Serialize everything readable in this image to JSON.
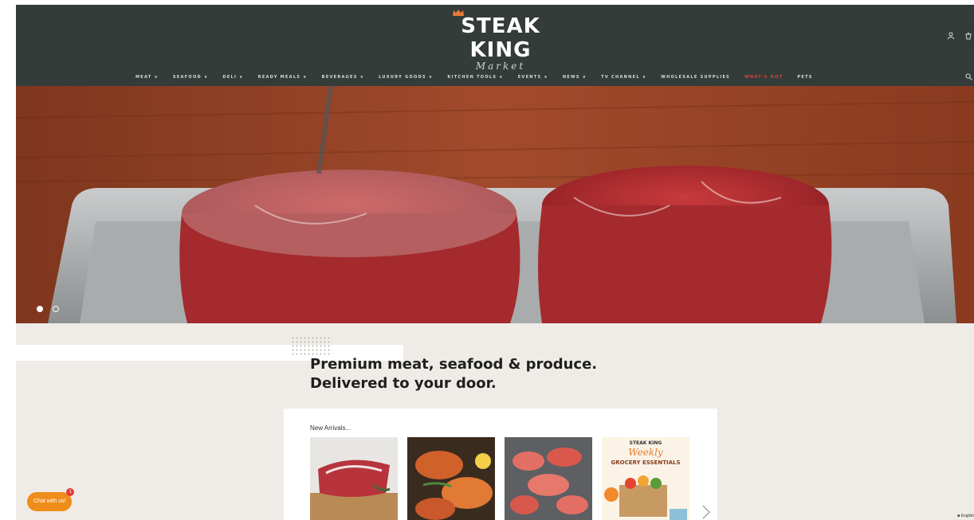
{
  "brand": {
    "title": "STEAK KING",
    "subtitle": "Market"
  },
  "nav": {
    "items": [
      "MEAT ∨",
      "SEAFOOD ∨",
      "DELI ∨",
      "READY MEALS ∨",
      "BEVERAGES ∨",
      "LUXURY GOODS ∨",
      "KITCHEN TOOLS ∨",
      "EVENTS ∨",
      "NEWS ∨",
      "TV CHANNEL ∨",
      "WHOLESALE SUPPLIES",
      "WHAT'S HOT",
      "PETS"
    ],
    "highlight_index": 11
  },
  "hero": {
    "slides": 2,
    "active_slide": 0
  },
  "tagline": "Premium meat, seafood & produce. Delivered to your door.",
  "new_arrivals": {
    "title": "New Arrivals...",
    "products": [
      {
        "image": "beef-cut-on-board"
      },
      {
        "image": "grilled-lobster-tails"
      },
      {
        "image": "crab-claws"
      },
      {
        "image": "weekly-grocery-essentials-poster"
      }
    ],
    "poster_text": {
      "brand": "STEAK KING",
      "line1": "Weekly",
      "line2": "GROCERY ESSENTIALS"
    }
  },
  "chat": {
    "label": "Chat with us!",
    "badge": "1"
  },
  "language": "English",
  "colors": {
    "header": "#343c3a",
    "page": "#efece7",
    "accent": "#ef8d1a",
    "highlight": "#d6473b"
  }
}
